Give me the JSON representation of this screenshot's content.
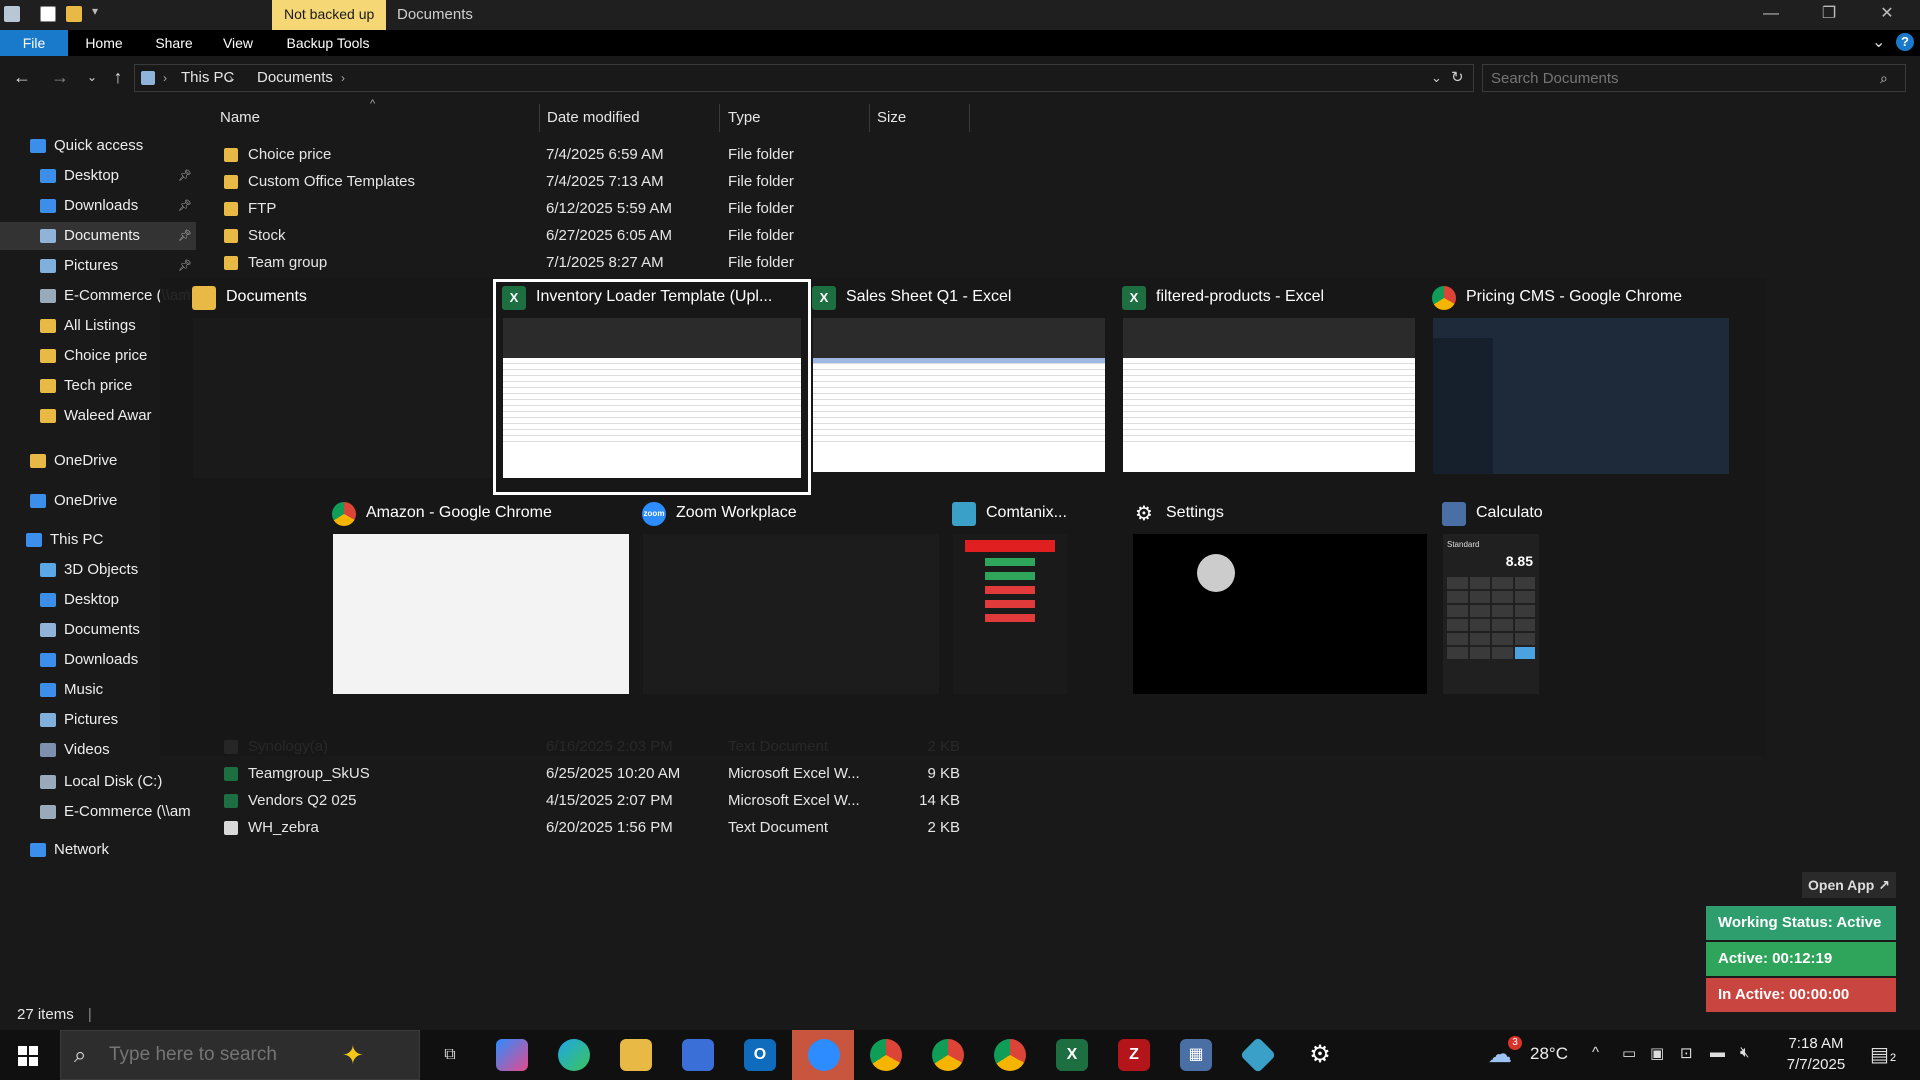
{
  "titlebar": {
    "badge": "Not backed up",
    "title": "Documents"
  },
  "ribbon": {
    "tabs": [
      "File",
      "Home",
      "Share",
      "View",
      "Backup Tools"
    ]
  },
  "address": {
    "crumbs": [
      "This PC",
      "Documents"
    ],
    "search_placeholder": "Search Documents"
  },
  "nav": {
    "items": [
      {
        "label": "Quick access",
        "icon": "star-icon",
        "color": "#3b8eea"
      },
      {
        "label": "Desktop",
        "icon": "desktop-icon",
        "color": "#3b8eea",
        "pinned": true
      },
      {
        "label": "Downloads",
        "icon": "download-icon",
        "color": "#3b8eea",
        "pinned": true
      },
      {
        "label": "Documents",
        "icon": "document-icon",
        "color": "#8fb3d9",
        "pinned": true,
        "selected": true
      },
      {
        "label": "Pictures",
        "icon": "pictures-icon",
        "color": "#7fb0dd",
        "pinned": true
      },
      {
        "label": "E-Commerce (\\\\am",
        "icon": "network-drive-icon",
        "color": "#9ab",
        "pinned": true
      },
      {
        "label": "All Listings",
        "icon": "folder-icon",
        "color": "#e8b945"
      },
      {
        "label": "Choice price",
        "icon": "folder-icon",
        "color": "#e8b945"
      },
      {
        "label": "Tech price",
        "icon": "folder-icon",
        "color": "#e8b945"
      },
      {
        "label": "Waleed Awar",
        "icon": "folder-icon",
        "color": "#e8b945"
      },
      {
        "label": "OneDrive",
        "icon": "folder-icon",
        "color": "#e8b945"
      },
      {
        "label": "OneDrive",
        "icon": "cloud-icon",
        "color": "#3b8eea"
      },
      {
        "label": "This PC",
        "icon": "pc-icon",
        "color": "#3b8eea"
      },
      {
        "label": "3D Objects",
        "icon": "cube-icon",
        "color": "#5aa9e6"
      },
      {
        "label": "Desktop",
        "icon": "desktop-icon",
        "color": "#3b8eea"
      },
      {
        "label": "Documents",
        "icon": "document-icon",
        "color": "#8fb3d9"
      },
      {
        "label": "Downloads",
        "icon": "download-icon",
        "color": "#3b8eea"
      },
      {
        "label": "Music",
        "icon": "music-icon",
        "color": "#3b8eea"
      },
      {
        "label": "Pictures",
        "icon": "pictures-icon",
        "color": "#7fb0dd"
      },
      {
        "label": "Videos",
        "icon": "video-icon",
        "color": "#7f8fb0"
      },
      {
        "label": "Local Disk (C:)",
        "icon": "disk-icon",
        "color": "#9ab"
      },
      {
        "label": "E-Commerce (\\\\am",
        "icon": "network-drive-icon",
        "color": "#9ab"
      },
      {
        "label": "Network",
        "icon": "network-icon",
        "color": "#3b8eea"
      }
    ]
  },
  "filelist": {
    "columns": [
      "Name",
      "Date modified",
      "Type",
      "Size"
    ],
    "rows": [
      {
        "name": "Choice price",
        "date": "7/4/2025 6:59 AM",
        "type": "File folder",
        "size": "",
        "icon": "folder"
      },
      {
        "name": "Custom Office Templates",
        "date": "7/4/2025 7:13 AM",
        "type": "File folder",
        "size": "",
        "icon": "folder"
      },
      {
        "name": "FTP",
        "date": "6/12/2025 5:59 AM",
        "type": "File folder",
        "size": "",
        "icon": "folder"
      },
      {
        "name": "Stock",
        "date": "6/27/2025 6:05 AM",
        "type": "File folder",
        "size": "",
        "icon": "folder"
      },
      {
        "name": "Team group",
        "date": "7/1/2025 8:27 AM",
        "type": "File folder",
        "size": "",
        "icon": "folder"
      },
      {
        "name": "Synology(a)",
        "date": "6/16/2025 2:03 PM",
        "type": "Text Document",
        "size": "2 KB",
        "icon": "text"
      },
      {
        "name": "Teamgroup_SkUS",
        "date": "6/25/2025 10:20 AM",
        "type": "Microsoft Excel W...",
        "size": "9 KB",
        "icon": "excel"
      },
      {
        "name": "Vendors Q2 025",
        "date": "4/15/2025 2:07 PM",
        "type": "Microsoft Excel W...",
        "size": "14 KB",
        "icon": "excel"
      },
      {
        "name": "WH_zebra",
        "date": "6/20/2025 1:56 PM",
        "type": "Text Document",
        "size": "2 KB",
        "icon": "text"
      }
    ]
  },
  "switcher": {
    "cards": [
      {
        "title": "Documents",
        "icon": "folder-icon",
        "app_color": "#e8b945"
      },
      {
        "title": "Inventory Loader Template (Upl...",
        "icon": "excel-icon",
        "app_color": "#1d6f42",
        "selected": true
      },
      {
        "title": "Sales Sheet Q1 - Excel",
        "icon": "excel-icon",
        "app_color": "#1d6f42"
      },
      {
        "title": "filtered-products - Excel",
        "icon": "excel-icon",
        "app_color": "#1d6f42"
      },
      {
        "title": "Pricing CMS - Google Chrome",
        "icon": "chrome-icon",
        "app_color": "#db4437"
      },
      {
        "title": "Amazon - Google Chrome",
        "icon": "chrome-icon",
        "app_color": "#db4437"
      },
      {
        "title": "Zoom Workplace",
        "icon": "zoom-icon",
        "app_color": "#2d8cff",
        "icon_text": "zoom"
      },
      {
        "title": "Comtanix...",
        "icon": "comtanix-icon",
        "app_color": "#3aa0c8"
      },
      {
        "title": "Settings",
        "icon": "gear-icon",
        "app_color": "#555"
      },
      {
        "title": "Calculator",
        "icon": "calculator-icon",
        "app_color": "#4a6fa5"
      }
    ],
    "calc_display": "8.85",
    "calc_mode": "Standard"
  },
  "statusbar": {
    "items_count": "27 items"
  },
  "widget": {
    "open_app": "Open App ↗",
    "working_status": "Working Status: Active",
    "active": "Active: 00:12:19",
    "inactive": "In Active: 00:00:00",
    "colors": {
      "working": "#2e9e6e",
      "active": "#2ea55a",
      "inactive": "#c9453f"
    }
  },
  "taskbar": {
    "search_placeholder": "Type here to search",
    "temperature": "28°C",
    "weather_badge": "3",
    "time": "7:18 AM",
    "date": "7/7/2025",
    "notif_count": "2"
  }
}
